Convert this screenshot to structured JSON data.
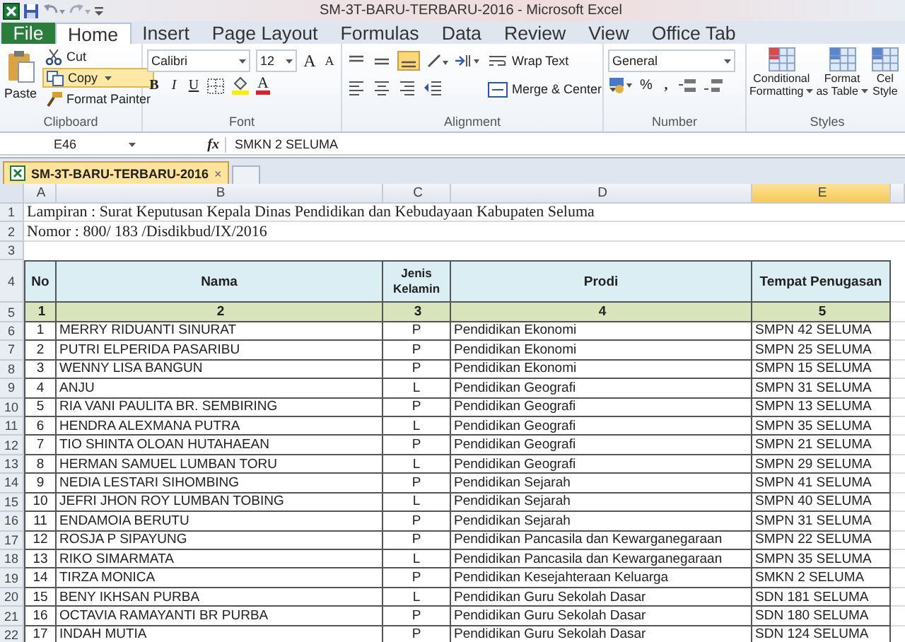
{
  "window": {
    "title": "SM-3T-BARU-TERBARU-2016  -  Microsoft Excel"
  },
  "ribbon_tabs": [
    {
      "label": "File",
      "kind": "file",
      "selected": false
    },
    {
      "label": "Home",
      "kind": "tab",
      "selected": true
    },
    {
      "label": "Insert",
      "kind": "tab",
      "selected": false
    },
    {
      "label": "Page Layout",
      "kind": "tab",
      "selected": false
    },
    {
      "label": "Formulas",
      "kind": "tab",
      "selected": false
    },
    {
      "label": "Data",
      "kind": "tab",
      "selected": false
    },
    {
      "label": "Review",
      "kind": "tab",
      "selected": false
    },
    {
      "label": "View",
      "kind": "tab",
      "selected": false
    },
    {
      "label": "Office Tab",
      "kind": "tab",
      "selected": false
    }
  ],
  "clipboard": {
    "paste": "Paste",
    "cut": "Cut",
    "copy": {
      "label": "Copy",
      "highlighted": true
    },
    "format_painter": "Format Painter",
    "group_label": "Clipboard"
  },
  "font": {
    "name": "Calibri",
    "size": "12",
    "grow": "A",
    "shrink": "A",
    "bold": "B",
    "italic": "I",
    "underline": "U",
    "font_color": "A",
    "group_label": "Font"
  },
  "alignment": {
    "wrap_text": "Wrap Text",
    "merge_center": "Merge & Center",
    "bottom_align_active": true,
    "group_label": "Alignment"
  },
  "number": {
    "format": "General",
    "percent": "%",
    "comma": ",",
    "group_label": "Number"
  },
  "styles": {
    "buttons": [
      {
        "line1": "Conditional",
        "line2": "Formatting"
      },
      {
        "line1": "Format",
        "line2": "as Table"
      },
      {
        "line1": "Cel",
        "line2": "Style"
      }
    ],
    "group_label": "Styles"
  },
  "formula_bar": {
    "name_box": "E46",
    "function_label": "fx",
    "value": "SMKN 2 SELUMA"
  },
  "workbook_tabs": [
    {
      "label": "SM-3T-BARU-TERBARU-2016",
      "close": "×",
      "selected": true
    }
  ],
  "sheet": {
    "columns": [
      {
        "label": "A",
        "selected": false
      },
      {
        "label": "B",
        "selected": false
      },
      {
        "label": "C",
        "selected": false
      },
      {
        "label": "D",
        "selected": false
      },
      {
        "label": "E",
        "selected": true
      }
    ],
    "row_numbers": [
      "1",
      "2",
      "3",
      "4",
      "5",
      "6",
      "7",
      "8",
      "9",
      "10",
      "11",
      "12",
      "13",
      "14",
      "15",
      "16",
      "17",
      "18",
      "19",
      "20",
      "21",
      "22"
    ],
    "title_lines": [
      "Lampiran : Surat Keputusan Kepala Dinas Pendidikan dan Kebudayaan Kabupaten Seluma",
      "Nomor : 800/  183  /Disdikbud/IX/2016"
    ],
    "header": [
      "No",
      "Nama",
      "Jenis Kelamin",
      "Prodi",
      "Tempat Penugasan"
    ],
    "index_row": [
      "1",
      "2",
      "3",
      "4",
      "5"
    ],
    "rows": [
      [
        "1",
        "MERRY RIDUANTI SINURAT",
        "P",
        "Pendidikan Ekonomi",
        "SMPN 42 SELUMA"
      ],
      [
        "2",
        "PUTRI ELPERIDA PASARIBU",
        "P",
        "Pendidikan Ekonomi",
        "SMPN 25 SELUMA"
      ],
      [
        "3",
        "WENNY LISA BANGUN",
        "P",
        "Pendidikan Ekonomi",
        "SMPN 15 SELUMA"
      ],
      [
        "4",
        "ANJU",
        "L",
        "Pendidikan Geografi",
        "SMPN 31 SELUMA"
      ],
      [
        "5",
        "RIA VANI PAULITA BR. SEMBIRING",
        "P",
        "Pendidikan Geografi",
        "SMPN 13 SELUMA"
      ],
      [
        "6",
        "HENDRA ALEXMANA PUTRA",
        "L",
        "Pendidikan Geografi",
        "SMPN 35 SELUMA"
      ],
      [
        "7",
        "TIO SHINTA OLOAN HUTAHAEAN",
        "P",
        "Pendidikan Geografi",
        "SMPN 21 SELUMA"
      ],
      [
        "8",
        "HERMAN SAMUEL LUMBAN TORU",
        "L",
        "Pendidikan Geografi",
        "SMPN 29 SELUMA"
      ],
      [
        "9",
        "NEDIA LESTARI SIHOMBING",
        "P",
        "Pendidikan Sejarah",
        "SMPN 41 SELUMA"
      ],
      [
        "10",
        "JEFRI JHON ROY LUMBAN TOBING",
        "L",
        "Pendidikan Sejarah",
        "SMPN 40 SELUMA"
      ],
      [
        "11",
        "ENDAMOIA BERUTU",
        "P",
        "Pendidikan Sejarah",
        "SMPN 31 SELUMA"
      ],
      [
        "12",
        "ROSJA P SIPAYUNG",
        "P",
        "Pendidikan Pancasila dan Kewarganegaraan",
        "SMPN 22 SELUMA"
      ],
      [
        "13",
        "RIKO SIMARMATA",
        "L",
        "Pendidikan Pancasila dan Kewarganegaraan",
        "SMPN 35 SELUMA"
      ],
      [
        "14",
        "TIRZA MONICA",
        "P",
        "Pendidikan Kesejahteraan Keluarga",
        "SMKN 2 SELUMA"
      ],
      [
        "15",
        "BENY IKHSAN PURBA",
        "L",
        "Pendidikan Guru Sekolah Dasar",
        "SDN 181 SELUMA"
      ],
      [
        "16",
        "OCTAVIA RAMAYANTI BR PURBA",
        "P",
        "Pendidikan Guru Sekolah Dasar",
        "SDN 180 SELUMA"
      ],
      [
        "17",
        "INDAH MUTIA",
        "P",
        "Pendidikan Guru Sekolah Dasar",
        "SDN 124 SELUMA"
      ]
    ]
  }
}
